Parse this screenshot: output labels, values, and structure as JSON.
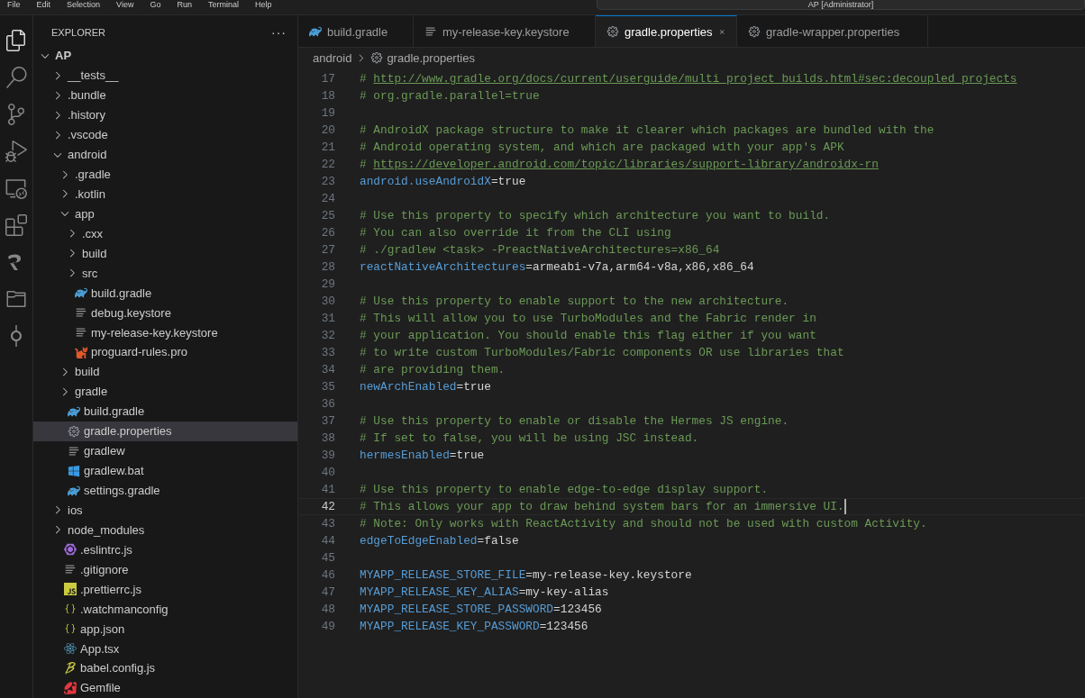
{
  "menu_bar": {
    "items": [
      "File",
      "Edit",
      "Selection",
      "View",
      "Go",
      "Run",
      "Terminal",
      "Help"
    ],
    "command_center": "AP [Administrator]"
  },
  "activity_bar": [
    {
      "kind": "explorer",
      "selected": true
    },
    {
      "kind": "search",
      "selected": false
    },
    {
      "kind": "source-control",
      "selected": false
    },
    {
      "kind": "run",
      "selected": false
    },
    {
      "kind": "remote",
      "selected": false
    },
    {
      "kind": "extensions",
      "selected": false
    },
    {
      "kind": "logo",
      "selected": false
    },
    {
      "kind": "folder",
      "selected": false
    },
    {
      "kind": "git",
      "selected": false
    }
  ],
  "sidebar": {
    "title": "EXPLORER",
    "more": "···",
    "tree": [
      {
        "name": "AP",
        "kind": "folder",
        "expanded": true,
        "selected": false,
        "children": [
          {
            "name": "__tests__",
            "kind": "folder",
            "expanded": false,
            "selected": false
          },
          {
            "name": ".bundle",
            "kind": "folder",
            "expanded": false,
            "selected": false
          },
          {
            "name": ".history",
            "kind": "folder",
            "expanded": false,
            "selected": false
          },
          {
            "name": ".vscode",
            "kind": "folder",
            "expanded": false,
            "selected": false
          },
          {
            "name": "android",
            "kind": "folder",
            "expanded": true,
            "selected": false,
            "children": [
              {
                "name": ".gradle",
                "kind": "folder",
                "expanded": false,
                "selected": false
              },
              {
                "name": ".kotlin",
                "kind": "folder",
                "expanded": false,
                "selected": false
              },
              {
                "name": "app",
                "kind": "folder",
                "expanded": true,
                "selected": false,
                "children": [
                  {
                    "name": ".cxx",
                    "kind": "folder",
                    "expanded": false,
                    "selected": false
                  },
                  {
                    "name": "build",
                    "kind": "folder",
                    "expanded": false,
                    "selected": false
                  },
                  {
                    "name": "src",
                    "kind": "folder",
                    "expanded": false,
                    "selected": false
                  },
                  {
                    "name": "build.gradle",
                    "kind": "gradle",
                    "selected": false
                  },
                  {
                    "name": "debug.keystore",
                    "kind": "text",
                    "selected": false
                  },
                  {
                    "name": "my-release-key.keystore",
                    "kind": "text",
                    "selected": false
                  },
                  {
                    "name": "proguard-rules.pro",
                    "kind": "proguard",
                    "selected": false
                  }
                ]
              },
              {
                "name": "build",
                "kind": "folder",
                "expanded": false,
                "selected": false
              },
              {
                "name": "gradle",
                "kind": "folder",
                "expanded": false,
                "selected": false
              },
              {
                "name": "build.gradle",
                "kind": "gradle",
                "selected": false
              },
              {
                "name": "gradle.properties",
                "kind": "gear",
                "selected": true
              },
              {
                "name": "gradlew",
                "kind": "text",
                "selected": false
              },
              {
                "name": "gradlew.bat",
                "kind": "windows",
                "selected": false
              },
              {
                "name": "settings.gradle",
                "kind": "gradle",
                "selected": false
              }
            ]
          },
          {
            "name": "ios",
            "kind": "folder",
            "expanded": false,
            "selected": false
          },
          {
            "name": "node_modules",
            "kind": "folder",
            "expanded": false,
            "selected": false
          },
          {
            "name": ".eslintrc.js",
            "kind": "eslint",
            "selected": false
          },
          {
            "name": ".gitignore",
            "kind": "text",
            "selected": false
          },
          {
            "name": ".prettierrc.js",
            "kind": "js",
            "selected": false
          },
          {
            "name": ".watchmanconfig",
            "kind": "json",
            "selected": false
          },
          {
            "name": "app.json",
            "kind": "json",
            "selected": false
          },
          {
            "name": "App.tsx",
            "kind": "react",
            "selected": false
          },
          {
            "name": "babel.config.js",
            "kind": "babel",
            "selected": false
          },
          {
            "name": "Gemfile",
            "kind": "ruby",
            "selected": false
          }
        ]
      }
    ]
  },
  "tabs": [
    {
      "label": "build.gradle",
      "kind": "gradle",
      "selected": false
    },
    {
      "label": "my-release-key.keystore",
      "kind": "text",
      "selected": false
    },
    {
      "label": "gradle.properties",
      "kind": "gear",
      "selected": true
    },
    {
      "label": "gradle-wrapper.properties",
      "kind": "gear",
      "selected": false
    }
  ],
  "breadcrumb": [
    {
      "label": "android",
      "kind": "folder"
    },
    {
      "label": "gradle.properties",
      "kind": "gear"
    }
  ],
  "editor": {
    "lines": [
      {
        "number": "17",
        "current": false,
        "segments": [
          {
            "kind": "comment",
            "text": "# "
          },
          {
            "kind": "link",
            "text": "http://www.gradle.org/docs/current/userguide/multi_project_builds.html#sec:decoupled_projects"
          }
        ]
      },
      {
        "number": "18",
        "current": false,
        "segments": [
          {
            "kind": "comment",
            "text": "# org.gradle.parallel=true"
          }
        ]
      },
      {
        "number": "19",
        "current": false
      },
      {
        "number": "20",
        "current": false,
        "segments": [
          {
            "kind": "comment",
            "text": "# AndroidX package structure to make it clearer which packages are bundled with the"
          }
        ]
      },
      {
        "number": "21",
        "current": false,
        "segments": [
          {
            "kind": "comment",
            "text": "# Android operating system, and which are packaged with your app's APK"
          }
        ]
      },
      {
        "number": "22",
        "current": false,
        "segments": [
          {
            "kind": "comment",
            "text": "# "
          },
          {
            "kind": "link",
            "text": "https://developer.android.com/topic/libraries/support-library/androidx-rn"
          }
        ]
      },
      {
        "number": "23",
        "current": false,
        "segments": [
          {
            "kind": "key",
            "text": "android.useAndroidX"
          },
          {
            "kind": "value",
            "text": "=true"
          }
        ]
      },
      {
        "number": "24",
        "current": false
      },
      {
        "number": "25",
        "current": false,
        "segments": [
          {
            "kind": "comment",
            "text": "# Use this property to specify which architecture you want to build."
          }
        ]
      },
      {
        "number": "26",
        "current": false,
        "segments": [
          {
            "kind": "comment",
            "text": "# You can also override it from the CLI using"
          }
        ]
      },
      {
        "number": "27",
        "current": false,
        "segments": [
          {
            "kind": "comment",
            "text": "# ./gradlew <task> -PreactNativeArchitectures=x86_64"
          }
        ]
      },
      {
        "number": "28",
        "current": false,
        "segments": [
          {
            "kind": "key",
            "text": "reactNativeArchitectures"
          },
          {
            "kind": "value",
            "text": "=armeabi-v7a,arm64-v8a,x86,x86_64"
          }
        ]
      },
      {
        "number": "29",
        "current": false
      },
      {
        "number": "30",
        "current": false,
        "segments": [
          {
            "kind": "comment",
            "text": "# Use this property to enable support to the new architecture."
          }
        ]
      },
      {
        "number": "31",
        "current": false,
        "segments": [
          {
            "kind": "comment",
            "text": "# This will allow you to use TurboModules and the Fabric render in"
          }
        ]
      },
      {
        "number": "32",
        "current": false,
        "segments": [
          {
            "kind": "comment",
            "text": "# your application. You should enable this flag either if you want"
          }
        ]
      },
      {
        "number": "33",
        "current": false,
        "segments": [
          {
            "kind": "comment",
            "text": "# to write custom TurboModules/Fabric components OR use libraries that"
          }
        ]
      },
      {
        "number": "34",
        "current": false,
        "segments": [
          {
            "kind": "comment",
            "text": "# are providing them."
          }
        ]
      },
      {
        "number": "35",
        "current": false,
        "segments": [
          {
            "kind": "key",
            "text": "newArchEnabled"
          },
          {
            "kind": "value",
            "text": "=true"
          }
        ]
      },
      {
        "number": "36",
        "current": false
      },
      {
        "number": "37",
        "current": false,
        "segments": [
          {
            "kind": "comment",
            "text": "# Use this property to enable or disable the Hermes JS engine."
          }
        ]
      },
      {
        "number": "38",
        "current": false,
        "segments": [
          {
            "kind": "comment",
            "text": "# If set to false, you will be using JSC instead."
          }
        ]
      },
      {
        "number": "39",
        "current": false,
        "segments": [
          {
            "kind": "key",
            "text": "hermesEnabled"
          },
          {
            "kind": "value",
            "text": "=true"
          }
        ]
      },
      {
        "number": "40",
        "current": false
      },
      {
        "number": "41",
        "current": false,
        "segments": [
          {
            "kind": "comment",
            "text": "# Use this property to enable edge-to-edge display support."
          }
        ]
      },
      {
        "number": "42",
        "current": true,
        "segments": [
          {
            "kind": "comment",
            "text": "# This allows your app to draw behind system bars for an immersive UI."
          }
        ]
      },
      {
        "number": "43",
        "current": false,
        "segments": [
          {
            "kind": "comment",
            "text": "# Note: Only works with ReactActivity and should not be used with custom Activity."
          }
        ]
      },
      {
        "number": "44",
        "current": false,
        "segments": [
          {
            "kind": "key",
            "text": "edgeToEdgeEnabled"
          },
          {
            "kind": "value",
            "text": "=false"
          }
        ]
      },
      {
        "number": "45",
        "current": false
      },
      {
        "number": "46",
        "current": false,
        "segments": [
          {
            "kind": "key",
            "text": "MYAPP_RELEASE_STORE_FILE"
          },
          {
            "kind": "value",
            "text": "=my-release-key.keystore"
          }
        ]
      },
      {
        "number": "47",
        "current": false,
        "segments": [
          {
            "kind": "key",
            "text": "MYAPP_RELEASE_KEY_ALIAS"
          },
          {
            "kind": "value",
            "text": "=my-key-alias"
          }
        ]
      },
      {
        "number": "48",
        "current": false,
        "segments": [
          {
            "kind": "key",
            "text": "MYAPP_RELEASE_STORE_PASSWORD"
          },
          {
            "kind": "value",
            "text": "=123456"
          }
        ]
      },
      {
        "number": "49",
        "current": false,
        "segments": [
          {
            "kind": "key",
            "text": "MYAPP_RELEASE_KEY_PASSWORD"
          },
          {
            "kind": "value",
            "text": "=123456"
          }
        ]
      }
    ]
  }
}
